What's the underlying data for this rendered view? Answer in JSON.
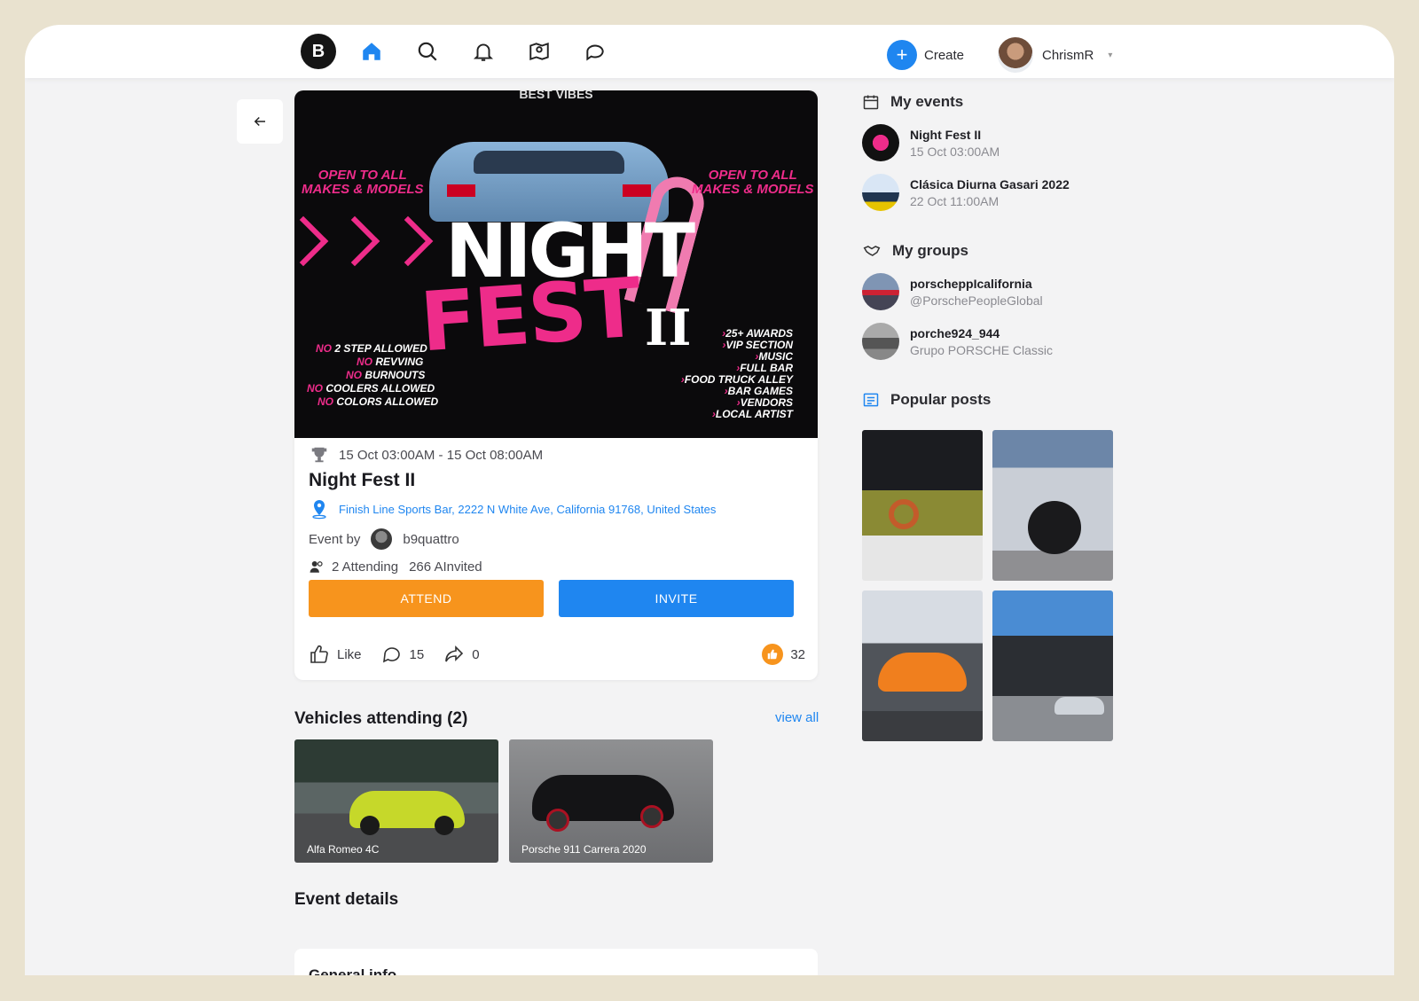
{
  "colors": {
    "accent_blue": "#1f86f0",
    "accent_orange": "#f7941d",
    "brand_pink": "#ee2c8a"
  },
  "nav": {
    "logo": "B",
    "icons": [
      "home-icon",
      "search-icon",
      "bell-icon",
      "map-icon",
      "chat-icon"
    ],
    "create_label": "Create",
    "user_name": "ChrismR"
  },
  "poster": {
    "header": "BEST VIBES",
    "title_line1": "NIGHT",
    "title_line2": "FEST",
    "numeral": "II",
    "open_line1": "OPEN TO ALL",
    "open_line2": "MAKES & MODELS",
    "rules": [
      {
        "prefix": "NO",
        "text": "2 STEP ALLOWED"
      },
      {
        "prefix": "NO",
        "text": "REVVING"
      },
      {
        "prefix": "NO",
        "text": "BURNOUTS"
      },
      {
        "prefix": "NO",
        "text": "COOLERS ALLOWED"
      },
      {
        "prefix": "NO",
        "text": "COLORS ALLOWED"
      }
    ],
    "perks": [
      "25+ AWARDS",
      "VIP SECTION",
      "MUSIC",
      "FULL BAR",
      "FOOD TRUCK ALLEY",
      "BAR GAMES",
      "VENDORS",
      "LOCAL ARTIST"
    ]
  },
  "event": {
    "dates": "15 Oct 03:00AM - 15 Oct 08:00AM",
    "title": "Night Fest II",
    "location": "Finish Line Sports Bar, 2222 N White Ave, California 91768, United States",
    "by_label": "Event by",
    "organizer": "b9quattro",
    "attending": "2 Attending",
    "invited": "266 AInvited",
    "attend_button": "ATTEND",
    "invite_button": "INVITE",
    "like_label": "Like",
    "comments": "15",
    "shares": "0",
    "reactions": "32"
  },
  "vehicles": {
    "heading": "Vehicles attending (2)",
    "view_all": "view all",
    "items": [
      {
        "name": "Alfa Romeo 4C"
      },
      {
        "name": "Porsche 911 Carrera 2020"
      }
    ]
  },
  "details": {
    "heading": "Event details",
    "general_info": "General info"
  },
  "sidebar": {
    "my_events": {
      "heading": "My events",
      "items": [
        {
          "title": "Night Fest II",
          "subtitle": "15 Oct 03:00AM"
        },
        {
          "title": "Clásica Diurna Gasari 2022",
          "subtitle": "22 Oct 11:00AM"
        }
      ]
    },
    "my_groups": {
      "heading": "My groups",
      "items": [
        {
          "title": "porscheppIcalifornia",
          "subtitle": "@PorschePeopleGlobal"
        },
        {
          "title": "porche924_944",
          "subtitle": "Grupo PORSCHE Classic"
        }
      ]
    },
    "popular_posts": {
      "heading": "Popular posts"
    }
  }
}
